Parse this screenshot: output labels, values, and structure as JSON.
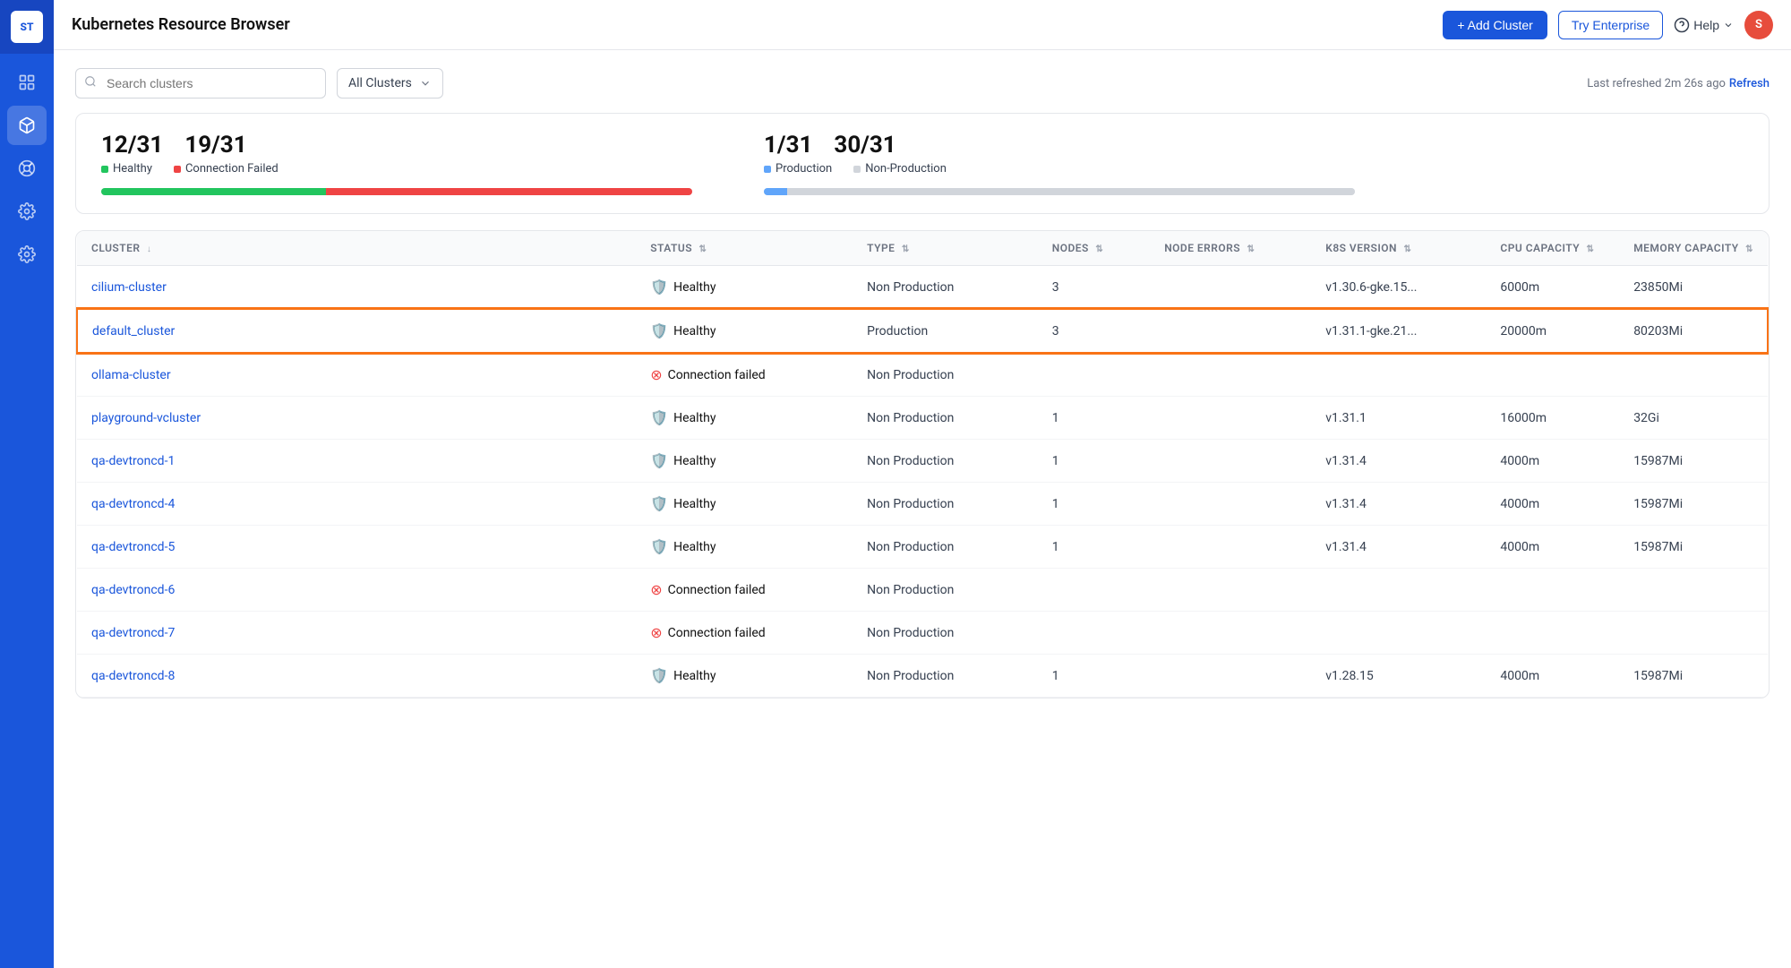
{
  "app": {
    "title": "Kubernetes Resource Browser"
  },
  "header": {
    "add_cluster_label": "+ Add Cluster",
    "try_enterprise_label": "Try Enterprise",
    "help_label": "Help",
    "avatar_initials": "S"
  },
  "toolbar": {
    "search_placeholder": "Search clusters",
    "filter_label": "All Clusters",
    "refresh_text": "Last refreshed 2m 26s ago",
    "refresh_link": "Refresh"
  },
  "stats": {
    "healthy_count": "12/31",
    "failed_count": "19/31",
    "healthy_label": "Healthy",
    "failed_label": "Connection Failed",
    "production_count": "1/31",
    "non_production_count": "30/31",
    "production_label": "Production",
    "non_production_label": "Non-Production",
    "healthy_pct": 38,
    "failed_pct": 62,
    "production_pct": 4,
    "non_production_pct": 96
  },
  "table": {
    "columns": [
      {
        "key": "cluster",
        "label": "CLUSTER",
        "sort": "↓"
      },
      {
        "key": "status",
        "label": "STATUS",
        "sort": "⇅"
      },
      {
        "key": "type",
        "label": "TYPE",
        "sort": "⇅"
      },
      {
        "key": "nodes",
        "label": "NODES",
        "sort": "⇅"
      },
      {
        "key": "node_errors",
        "label": "NODE ERRORS",
        "sort": "⇅"
      },
      {
        "key": "k8s_version",
        "label": "K8S VERSION",
        "sort": "⇅"
      },
      {
        "key": "cpu_capacity",
        "label": "CPU CAPACITY",
        "sort": "⇅"
      },
      {
        "key": "memory_capacity",
        "label": "MEMORY CAPACITY",
        "sort": "⇅"
      }
    ],
    "rows": [
      {
        "cluster": "cilium-cluster",
        "status": "Healthy",
        "status_type": "healthy",
        "type": "Non Production",
        "nodes": "3",
        "node_errors": "",
        "k8s_version": "v1.30.6-gke.15...",
        "cpu_capacity": "6000m",
        "memory_capacity": "23850Mi",
        "highlighted": false
      },
      {
        "cluster": "default_cluster",
        "status": "Healthy",
        "status_type": "healthy",
        "type": "Production",
        "nodes": "3",
        "node_errors": "",
        "k8s_version": "v1.31.1-gke.21...",
        "cpu_capacity": "20000m",
        "memory_capacity": "80203Mi",
        "highlighted": true
      },
      {
        "cluster": "ollama-cluster",
        "status": "Connection failed",
        "status_type": "failed",
        "type": "Non Production",
        "nodes": "",
        "node_errors": "",
        "k8s_version": "",
        "cpu_capacity": "",
        "memory_capacity": "",
        "highlighted": false
      },
      {
        "cluster": "playground-vcluster",
        "status": "Healthy",
        "status_type": "healthy",
        "type": "Non Production",
        "nodes": "1",
        "node_errors": "",
        "k8s_version": "v1.31.1",
        "cpu_capacity": "16000m",
        "memory_capacity": "32Gi",
        "highlighted": false
      },
      {
        "cluster": "qa-devtroncd-1",
        "status": "Healthy",
        "status_type": "healthy",
        "type": "Non Production",
        "nodes": "1",
        "node_errors": "",
        "k8s_version": "v1.31.4",
        "cpu_capacity": "4000m",
        "memory_capacity": "15987Mi",
        "highlighted": false
      },
      {
        "cluster": "qa-devtroncd-4",
        "status": "Healthy",
        "status_type": "healthy",
        "type": "Non Production",
        "nodes": "1",
        "node_errors": "",
        "k8s_version": "v1.31.4",
        "cpu_capacity": "4000m",
        "memory_capacity": "15987Mi",
        "highlighted": false
      },
      {
        "cluster": "qa-devtroncd-5",
        "status": "Healthy",
        "status_type": "healthy",
        "type": "Non Production",
        "nodes": "1",
        "node_errors": "",
        "k8s_version": "v1.31.4",
        "cpu_capacity": "4000m",
        "memory_capacity": "15987Mi",
        "highlighted": false
      },
      {
        "cluster": "qa-devtroncd-6",
        "status": "Connection failed",
        "status_type": "failed",
        "type": "Non Production",
        "nodes": "",
        "node_errors": "",
        "k8s_version": "",
        "cpu_capacity": "",
        "memory_capacity": "",
        "highlighted": false
      },
      {
        "cluster": "qa-devtroncd-7",
        "status": "Connection failed",
        "status_type": "failed",
        "type": "Non Production",
        "nodes": "",
        "node_errors": "",
        "k8s_version": "",
        "cpu_capacity": "",
        "memory_capacity": "",
        "highlighted": false
      },
      {
        "cluster": "qa-devtroncd-8",
        "status": "Healthy",
        "status_type": "healthy",
        "type": "Non Production",
        "nodes": "1",
        "node_errors": "",
        "k8s_version": "v1.28.15",
        "cpu_capacity": "4000m",
        "memory_capacity": "15987Mi",
        "highlighted": false
      }
    ]
  },
  "sidebar": {
    "logo": "ST",
    "items": [
      {
        "icon": "grid",
        "active": false
      },
      {
        "icon": "cube",
        "active": true
      },
      {
        "icon": "circle-nodes",
        "active": false
      },
      {
        "icon": "gear",
        "active": false
      },
      {
        "icon": "gear2",
        "active": false
      }
    ]
  }
}
